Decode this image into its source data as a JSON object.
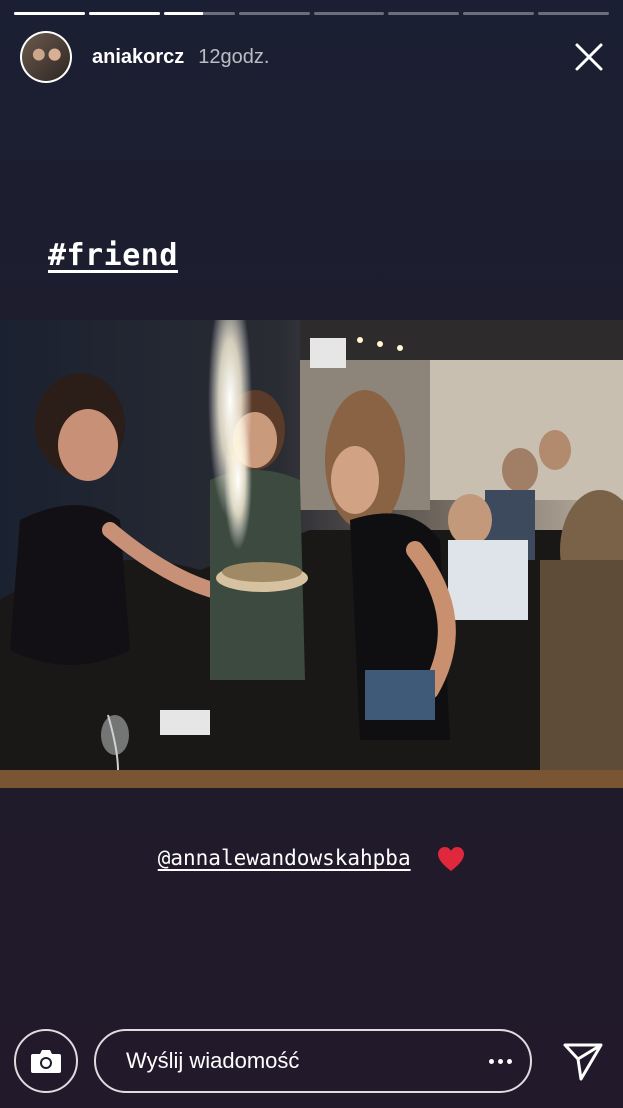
{
  "story": {
    "progress_segments": [
      1,
      1,
      0.55,
      0,
      0,
      0,
      0,
      0
    ],
    "username": "aniakorcz",
    "time_ago": "12godz.",
    "hashtag": "#friend",
    "mention": "@annalewandowskahpba",
    "mention_emoji": "red-heart"
  },
  "bottom_bar": {
    "message_placeholder": "Wyślij wiadomość"
  },
  "icons": {
    "close": "close-icon",
    "camera": "camera-icon",
    "more": "more-dots-icon",
    "send": "send-icon"
  },
  "colors": {
    "background": "#1d1d2e",
    "heart": "#e0283c"
  }
}
